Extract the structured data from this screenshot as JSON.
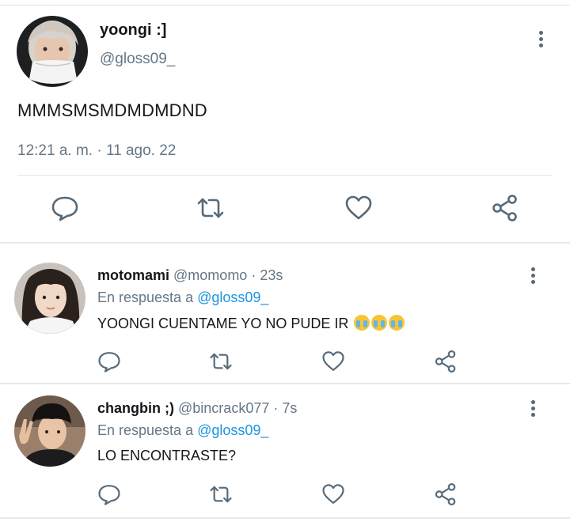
{
  "main_tweet": {
    "name": "yoongi :]",
    "handle": "@gloss09_",
    "text": "MMMSMSMDMDMDND",
    "timestamp": "12:21 a. m. · 11 ago. 22",
    "actions": [
      "reply-icon",
      "retweet-icon",
      "like-icon",
      "share-icon"
    ]
  },
  "replies": [
    {
      "name": "motomami",
      "handle": "@momomo",
      "time": "· 23s",
      "in_reply_prefix": "En respuesta a",
      "in_reply_handle": "@gloss09_",
      "text": "YOONGI CUENTAME YO NO PUDE IR",
      "emojis": [
        "loudly-crying-face",
        "loudly-crying-face",
        "loudly-crying-face"
      ]
    },
    {
      "name": "changbin ;)",
      "handle": "@bincrack077",
      "time": "· 7s",
      "in_reply_prefix": "En respuesta a",
      "in_reply_handle": "@gloss09_",
      "text": "LO ENCONTRASTE?"
    }
  ],
  "colors": {
    "text": "#14171a",
    "secondary": "#657786",
    "link": "#1b95e0",
    "icon": "#566a7a",
    "divider": "#e3e6e8"
  }
}
